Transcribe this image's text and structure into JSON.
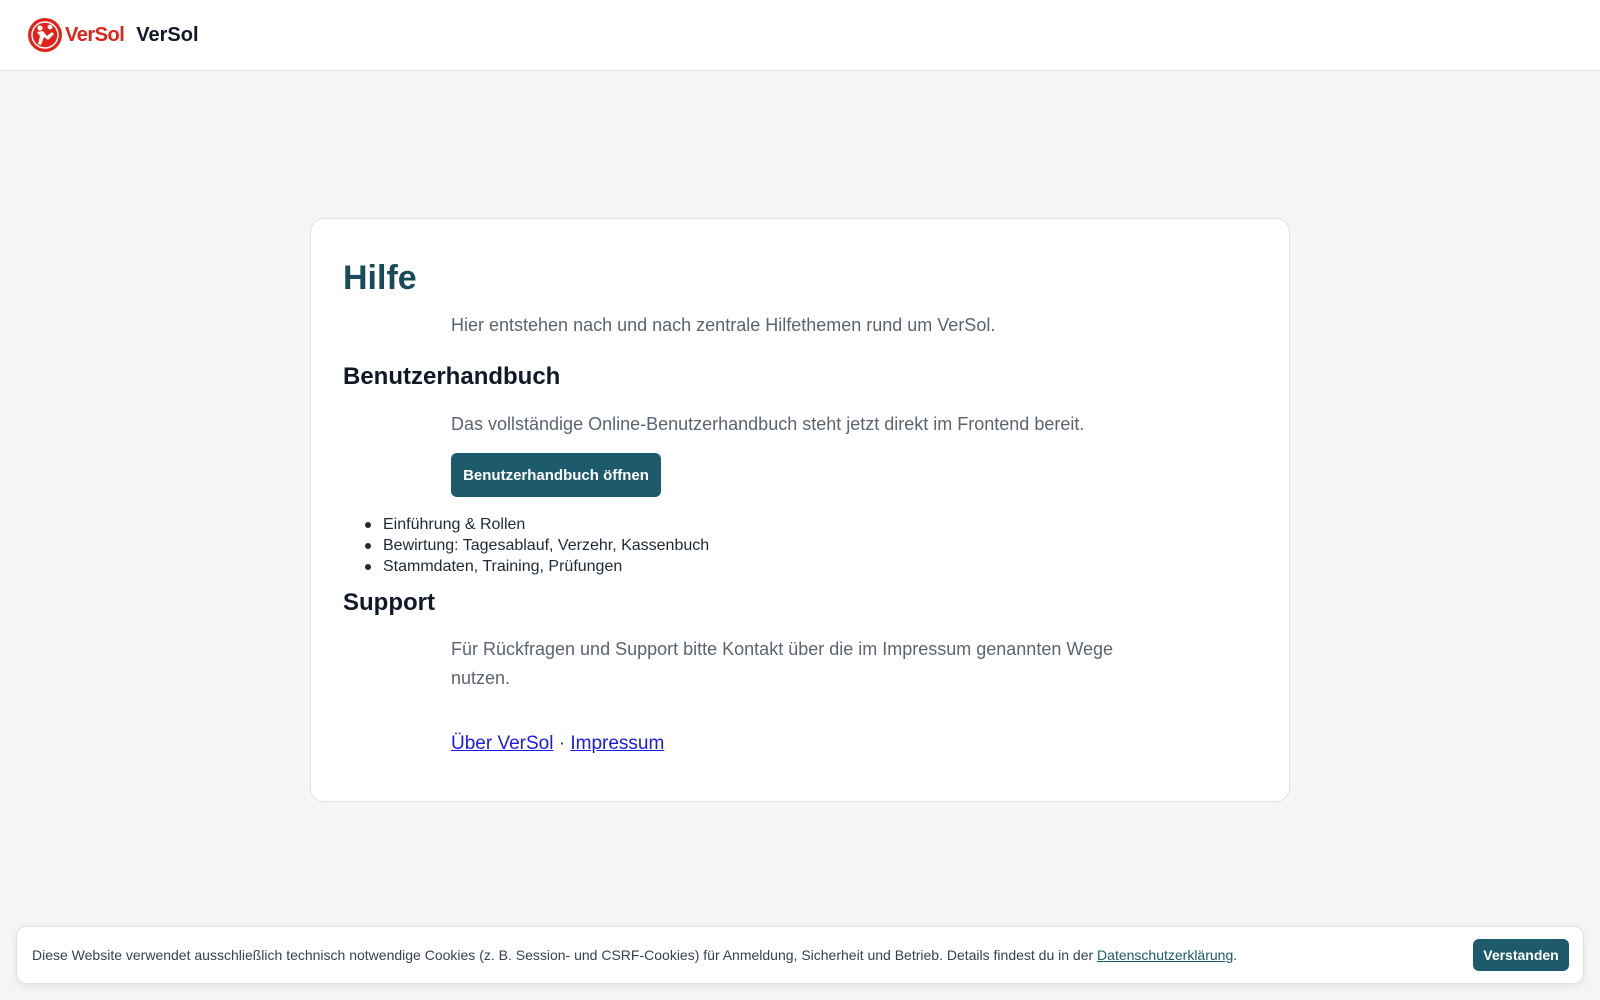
{
  "header": {
    "logo_text_a": "Ver",
    "logo_text_b": "Sol",
    "brand_name": "VerSol"
  },
  "main": {
    "title": "Hilfe",
    "intro": "Hier entstehen nach und nach zentrale Hilfethemen rund um VerSol.",
    "handbook": {
      "heading": "Benutzerhandbuch",
      "text": "Das vollständige Online-Benutzerhandbuch steht jetzt direkt im Frontend bereit.",
      "button_label": "Benutzerhandbuch öffnen",
      "topics": [
        "Einführung & Rollen",
        "Bewirtung: Tagesablauf, Verzehr, Kassenbuch",
        "Stammdaten, Training, Prüfungen"
      ]
    },
    "support": {
      "heading": "Support",
      "text": "Für Rückfragen und Support bitte Kontakt über die im Impressum genannten Wege nutzen."
    },
    "links": {
      "about": "Über VerSol",
      "separator": "·",
      "imprint": "Impressum"
    }
  },
  "cookie_banner": {
    "text": "Diese Website verwendet ausschließlich technisch notwendige Cookies (z. B. Session- und CSRF-Cookies) für Anmeldung, Sicherheit und Betrieb. Details findest du in der",
    "privacy_link": "Datenschutzerklärung",
    "suffix": ".",
    "accept_label": "Verstanden"
  },
  "colors": {
    "accent": "#1d5b6c",
    "title": "#194a5a",
    "logo_red": "#e2231a",
    "link": "#1a1aee",
    "background": "#f4f5f7"
  }
}
